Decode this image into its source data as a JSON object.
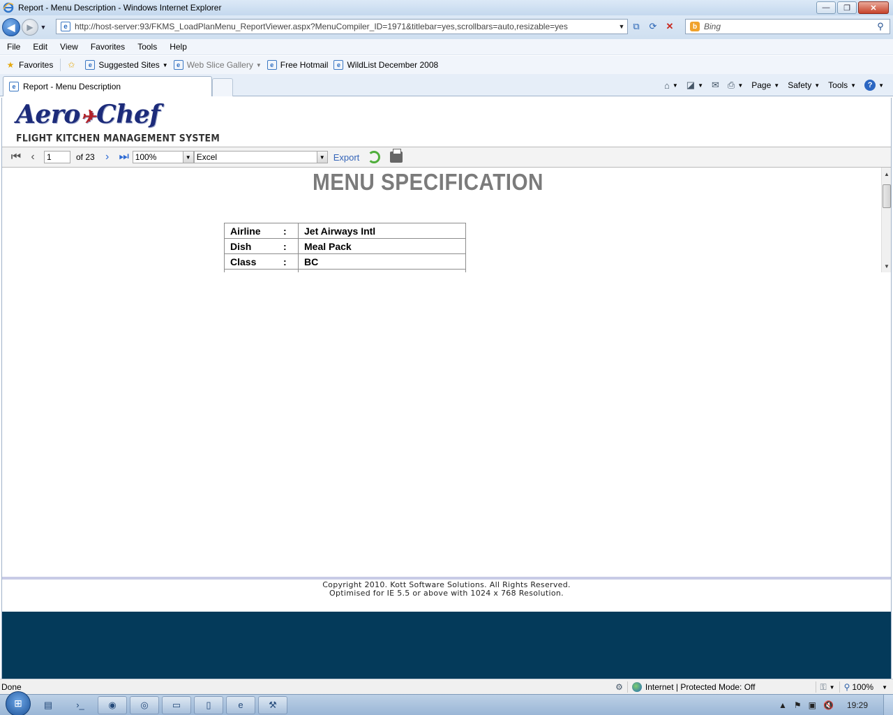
{
  "window": {
    "title": "Report - Menu Description - Windows Internet Explorer",
    "controls": {
      "minimize": "—",
      "restore": "❐",
      "close": "✕"
    }
  },
  "address_bar": {
    "url": "http://host-server:93/FKMS_LoadPlanMenu_ReportViewer.aspx?MenuCompiler_ID=1971&titlebar=yes,scrollbars=auto,resizable=yes",
    "search_placeholder": "Bing"
  },
  "menu": [
    "File",
    "Edit",
    "View",
    "Favorites",
    "Tools",
    "Help"
  ],
  "favorites_bar": {
    "favorites_label": "Favorites",
    "items": [
      "Suggested Sites",
      "Web Slice Gallery",
      "Free Hotmail",
      "WildList December 2008"
    ]
  },
  "tab": {
    "title": "Report - Menu Description"
  },
  "command_bar": {
    "page": "Page",
    "safety": "Safety",
    "tools": "Tools"
  },
  "logo": {
    "brand_left": "Aero",
    "brand_mark": "✈",
    "brand_right": "Chef",
    "tagline": "FLIGHT KITCHEN MANAGEMENT SYSTEM"
  },
  "report_toolbar": {
    "current_page": "1",
    "page_total": "of 23",
    "zoom": "100%",
    "export_format": "Excel",
    "export_label": "Export"
  },
  "report": {
    "title": "MENU SPECIFICATION",
    "rows": [
      {
        "key": "Airline",
        "sep": ":",
        "value": "Jet Airways Intl"
      },
      {
        "key": "Dish",
        "sep": ":",
        "value": "Meal Pack"
      },
      {
        "key": "Class",
        "sep": ":",
        "value": "BC"
      }
    ]
  },
  "footer": {
    "line1": "Copyright 2010. Kott Software Solutions. All Rights Reserved.",
    "line2": "Optimised for IE 5.5 or above with 1024 x 768 Resolution."
  },
  "status_bar": {
    "text": "Done",
    "zone": "Internet | Protected Mode: Off",
    "zoom": "100%"
  },
  "taskbar": {
    "clock": "19:29"
  },
  "colors": {
    "footer_band": "#043a5a",
    "report_title": "#7b7b7b",
    "export_link": "#3464b8"
  }
}
